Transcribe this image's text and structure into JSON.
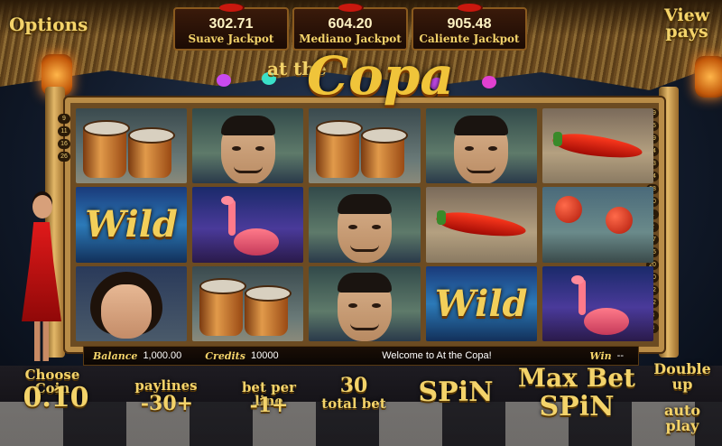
{
  "game": {
    "logo_top": "at the",
    "logo_main": "Copa"
  },
  "menu": {
    "options_label": "Options",
    "view_pays_label": "View pays"
  },
  "jackpots": [
    {
      "value": "302.71",
      "label": "Suave Jackpot"
    },
    {
      "value": "604.20",
      "label": "Mediano Jackpot"
    },
    {
      "value": "905.48",
      "label": "Caliente Jackpot"
    }
  ],
  "paylines_left": [
    "9",
    "11",
    "16",
    "26"
  ],
  "paylines_right": [
    "19",
    "25",
    "29",
    "24",
    "13",
    "14",
    "28",
    "10",
    "1",
    "2",
    "17",
    "15",
    "20",
    "30",
    "22",
    "12",
    "8",
    "3"
  ],
  "reels": [
    [
      "drums-icon",
      "wild-icon",
      "woman-icon"
    ],
    [
      "man-icon",
      "flamingo-icon",
      "drums-icon"
    ],
    [
      "drums-icon",
      "man-icon",
      "man-icon"
    ],
    [
      "man-icon",
      "chili-pepper-icon",
      "wild-icon"
    ],
    [
      "chili-pepper-icon",
      "maracas-icon",
      "flamingo-icon"
    ]
  ],
  "wild_text": "Wild",
  "info_bar": {
    "balance_label": "Balance",
    "balance_value": "1,000.00",
    "credits_label": "Credits",
    "credits_value": "10000",
    "message": "Welcome to At the Copa!",
    "win_label": "Win",
    "win_value": "--"
  },
  "controls": {
    "coin_label": "Choose Coin",
    "coin_value": "0.10",
    "paylines_label": "paylines",
    "paylines_value": "-30+",
    "bet_label": "bet per line",
    "bet_value": "-1+",
    "total_bet_value": "30",
    "total_bet_label": "total bet",
    "spin_label": "SPiN",
    "max_bet_label": "Max Bet",
    "max_bet_spin": "SPiN",
    "double_up_label": "Double up",
    "auto_play_label": "auto play"
  },
  "colors": {
    "gold": "#f3d36a",
    "bamboo": "#b98c47",
    "chili_red": "#c8180e"
  }
}
